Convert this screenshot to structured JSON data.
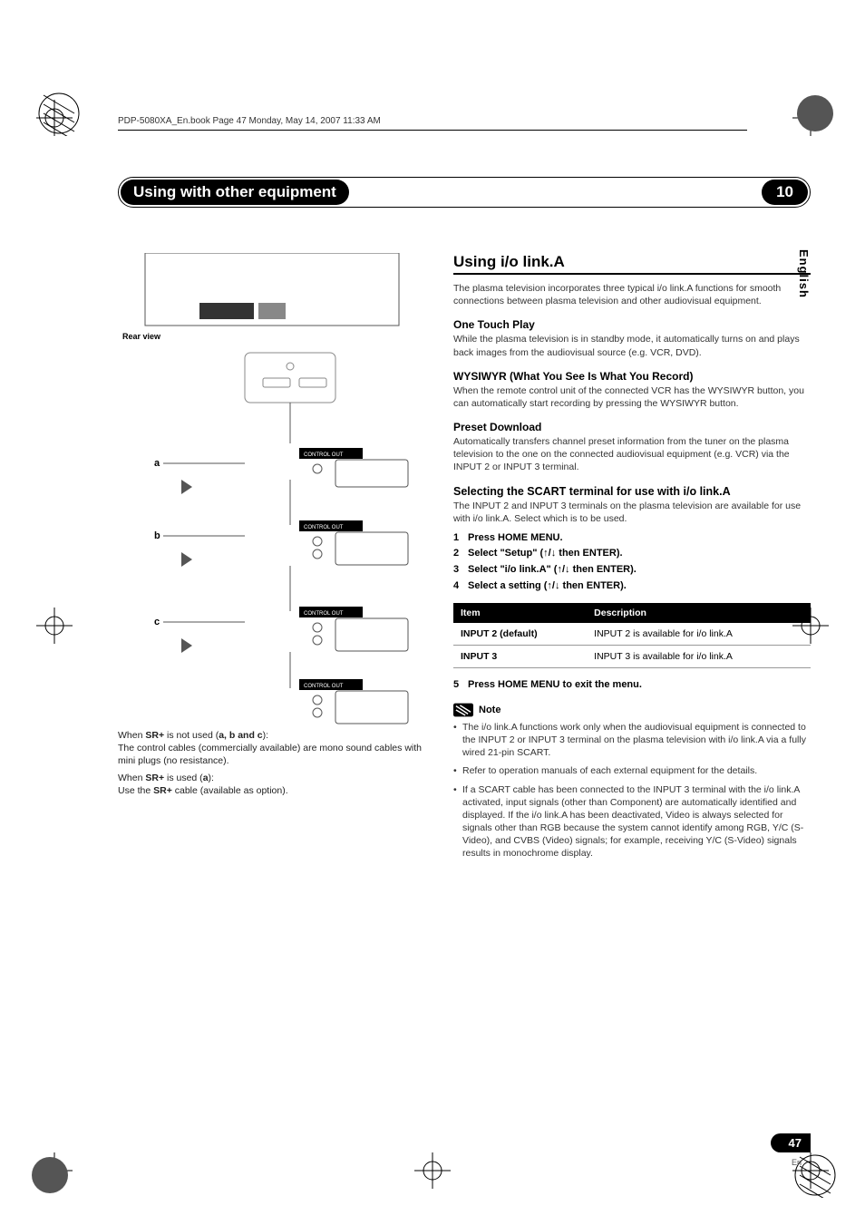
{
  "header_line": "PDP-5080XA_En.book  Page 47  Monday, May 14, 2007  11:33 AM",
  "chapter_title": "Using with other equipment",
  "chapter_number": "10",
  "language_tab": "English",
  "page_number": "47",
  "page_lang": "En",
  "left": {
    "rear_view_label": "Rear view",
    "diagram_labels": {
      "a": "a",
      "b": "b",
      "c": "c"
    },
    "control_out_label": "CONTROL OUT",
    "sr_not_used_prefix": "When ",
    "sr_plus": "SR+",
    "sr_not_used_mid": " is not used (",
    "sr_not_used_parts": "a, b and c",
    "sr_not_used_suffix": "):",
    "sr_not_used_body": "The control cables (commercially available) are mono sound cables with mini plugs (no resistance).",
    "sr_used_prefix": "When ",
    "sr_used_mid": " is used (",
    "sr_used_part": "a",
    "sr_used_suffix": "):",
    "sr_used_body_pre": "Use the ",
    "sr_used_body_post": " cable (available as option)."
  },
  "right": {
    "h2": "Using i/o link.A",
    "intro": "The plasma television incorporates three typical i/o link.A functions for smooth connections between plasma television and other audiovisual equipment.",
    "otp_h": "One Touch Play",
    "otp_body": "While the plasma television is in standby mode, it automatically turns on and plays back images from the audiovisual source (e.g. VCR, DVD).",
    "wys_h": "WYSIWYR (What You See Is What You Record)",
    "wys_body": "When the remote control unit of the connected VCR has the WYSIWYR button, you can automatically start recording by pressing the WYSIWYR button.",
    "pre_h": "Preset Download",
    "pre_body": "Automatically transfers channel preset information from the tuner on the plasma television to the one on the connected audiovisual equipment (e.g. VCR) via the INPUT 2 or INPUT 3 terminal.",
    "sel_h": "Selecting the SCART terminal for use with i/o link.A",
    "sel_body": "The INPUT 2 and INPUT 3 terminals on the plasma television are available for use with i/o link.A. Select which is to be used.",
    "steps": [
      {
        "n": "1",
        "t": "Press HOME MENU."
      },
      {
        "n": "2",
        "t": "Select \"Setup\" (↑/↓ then ENTER)."
      },
      {
        "n": "3",
        "t": "Select \"i/o link.A\" (↑/↓ then ENTER)."
      },
      {
        "n": "4",
        "t": "Select a setting (↑/↓ then ENTER)."
      }
    ],
    "table": {
      "head_item": "Item",
      "head_desc": "Description",
      "rows": [
        {
          "item": "INPUT 2 (default)",
          "desc": "INPUT 2 is available for i/o link.A"
        },
        {
          "item": "INPUT 3",
          "desc": "INPUT 3 is available for i/o link.A"
        }
      ]
    },
    "step5_n": "5",
    "step5_t": "Press HOME MENU to exit the menu.",
    "note_label": "Note",
    "notes": [
      "The i/o link.A functions work only when the audiovisual equipment is connected to the INPUT 2 or INPUT 3 terminal on the plasma television with i/o link.A via a fully wired 21-pin SCART.",
      "Refer to operation manuals of each external equipment for the details.",
      "If a SCART cable has been connected to the INPUT 3 terminal with the i/o link.A activated, input signals (other than Component) are automatically identified and displayed. If the i/o link.A has been deactivated, Video is always selected for signals other than RGB because the system cannot identify among RGB, Y/C (S-Video), and CVBS (Video) signals; for example, receiving Y/C (S-Video) signals results in monochrome display."
    ]
  }
}
